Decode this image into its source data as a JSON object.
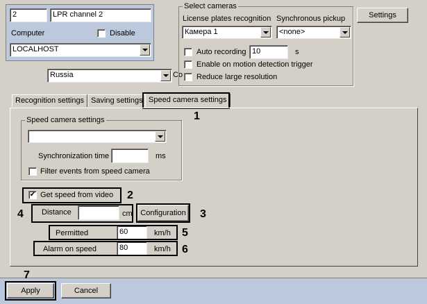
{
  "channel": {
    "number": "2",
    "name": "LPR channel 2"
  },
  "computer": {
    "label": "Computer",
    "value": "LOCALHOST",
    "disable_label": "Disable",
    "disable_checked": false
  },
  "region": {
    "value": "Russia",
    "truncated_label": "Co"
  },
  "select_cameras": {
    "legend": "Select cameras",
    "lpr_label": "License plates recognition",
    "lpr_value": "Камера 1",
    "sync_label": "Synchronous pickup",
    "sync_value": "<none>",
    "auto_recording_label": "Auto recording",
    "auto_recording_checked": false,
    "auto_recording_value": "10",
    "auto_recording_unit": "s",
    "motion_trigger_label": "Enable on motion detection trigger",
    "motion_trigger_checked": false,
    "large_res_label": "Reduce large resolution",
    "large_res_checked": false
  },
  "settings_button": "Settings",
  "tabs": [
    {
      "label": "Recognition settings",
      "active": false
    },
    {
      "label": "Saving settings",
      "active": false
    },
    {
      "label": "Speed camera settings",
      "active": true
    }
  ],
  "speed_camera": {
    "legend": "Speed camera settings",
    "camera_value": "",
    "sync_time_label": "Synchronization time",
    "sync_time_value": "",
    "sync_time_unit": "ms",
    "filter_label": "Filter events from speed camera",
    "filter_checked": false
  },
  "speed_from_video": {
    "label": "Get speed from video",
    "checked": true,
    "check_glyph": "✔"
  },
  "distance": {
    "label": "Distance",
    "value": "",
    "unit": "cm"
  },
  "configuration_button": "Configuration",
  "permitted": {
    "label": "Permitted",
    "value": "60",
    "unit": "km/h"
  },
  "alarm": {
    "label": "Alarm on speed",
    "value": "80",
    "unit": "km/h"
  },
  "footer": {
    "apply": "Apply",
    "cancel": "Cancel"
  },
  "callouts": [
    "1",
    "2",
    "3",
    "4",
    "5",
    "6",
    "7"
  ]
}
